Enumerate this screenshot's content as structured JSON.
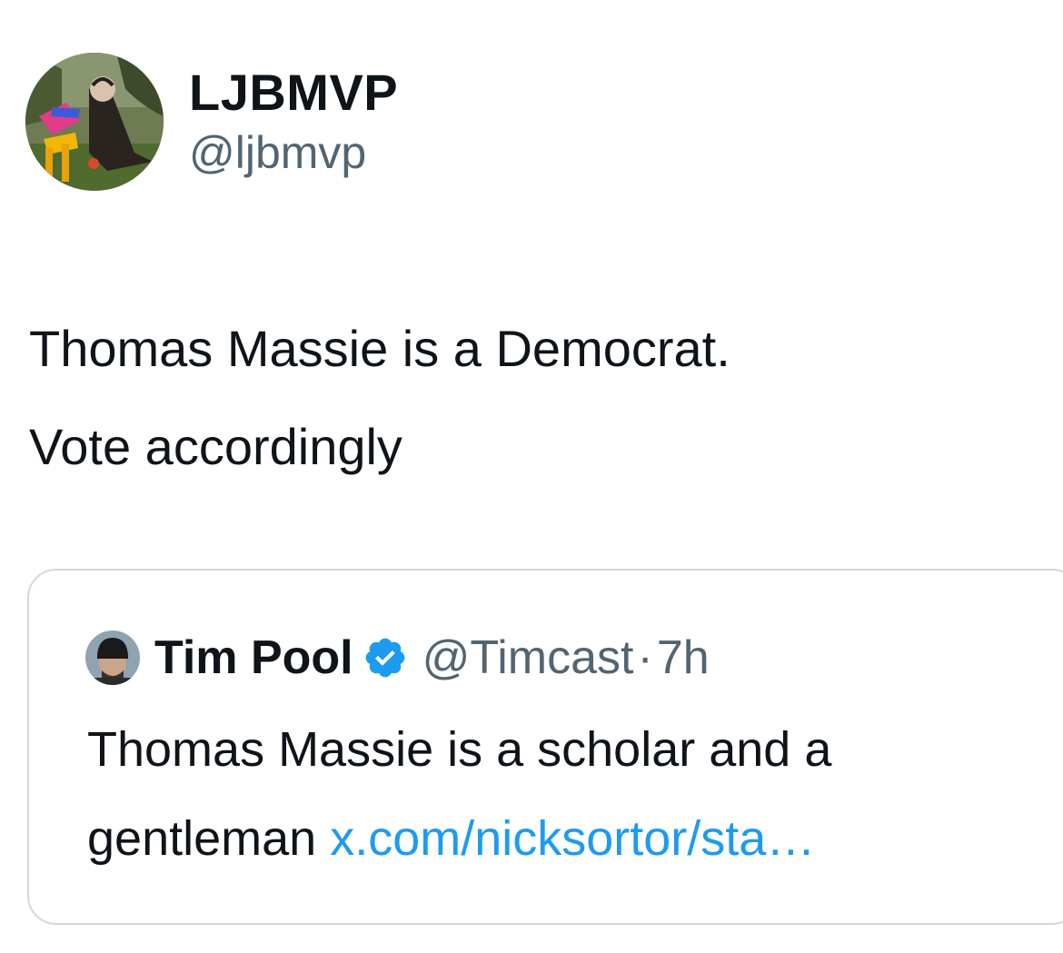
{
  "tweet": {
    "author": {
      "display_name": "LJBMVP",
      "handle": "@ljbmvp"
    },
    "text_lines": [
      "Thomas Massie is a Democrat.",
      "Vote accordingly"
    ]
  },
  "quoted_tweet": {
    "author": {
      "display_name": "Tim Pool",
      "verified": true,
      "handle": "@Timcast",
      "separator": "·",
      "time": "7h"
    },
    "text_line_1": "Thomas Massie is a scholar and a",
    "text_line_2_prefix": "gentleman",
    "link_text": "x.com/nicksortor/sta…"
  },
  "colors": {
    "text": "#0f1419",
    "secondary": "#536471",
    "link": "#1d9bf0",
    "border": "#cfd9de",
    "verified_badge": "#1d9bf0"
  },
  "icons": {
    "verified": "verified-badge-icon"
  }
}
